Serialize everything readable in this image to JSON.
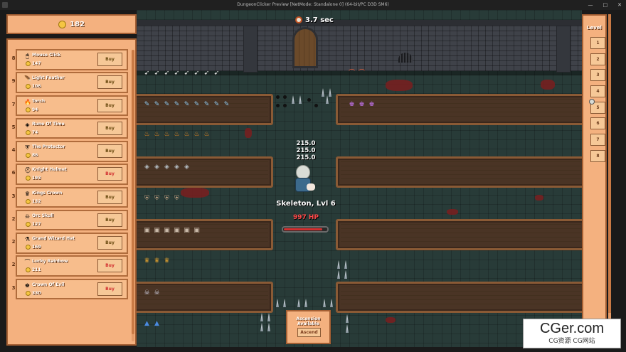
{
  "window": {
    "title": "DungeonClicker Preview [NetMode: Standalone 0] (64-bit/PC D3D SM6)",
    "controls": [
      "—",
      "□",
      "✕"
    ]
  },
  "hud": {
    "timer": "3.7 sec",
    "money": "182"
  },
  "shop": {
    "items": [
      {
        "count": "8",
        "name": "Mouse Click",
        "cost": "147",
        "icon": "mouse-icon",
        "glyph": "🖱",
        "buy": "Buy",
        "affordable": true
      },
      {
        "count": "9",
        "name": "Light Feather",
        "cost": "106",
        "icon": "feather-icon",
        "glyph": "🪶",
        "buy": "Buy",
        "affordable": true
      },
      {
        "count": "7",
        "name": "Torch",
        "cost": "94",
        "icon": "torch-icon",
        "glyph": "🔥",
        "buy": "Buy",
        "affordable": true
      },
      {
        "count": "5",
        "name": "Rune Of Time",
        "cost": "74",
        "icon": "rune-icon",
        "glyph": "◈",
        "buy": "Buy",
        "affordable": true
      },
      {
        "count": "4",
        "name": "The Protector",
        "cost": "86",
        "icon": "shield-icon",
        "glyph": "⛨",
        "buy": "Buy",
        "affordable": true
      },
      {
        "count": "6",
        "name": "Knight Helmet",
        "cost": "193",
        "icon": "helmet-icon",
        "glyph": "⛑",
        "buy": "Buy",
        "affordable": false
      },
      {
        "count": "3",
        "name": "Kings Crown",
        "cost": "132",
        "icon": "crown-icon",
        "glyph": "♛",
        "buy": "Buy",
        "affordable": true
      },
      {
        "count": "2",
        "name": "Orc Skull",
        "cost": "127",
        "icon": "skull-icon",
        "glyph": "☠",
        "buy": "Buy",
        "affordable": true
      },
      {
        "count": "2",
        "name": "Grand Wizard Hat",
        "cost": "169",
        "icon": "wizard-hat-icon",
        "glyph": "⚗",
        "buy": "Buy",
        "affordable": true
      },
      {
        "count": "2",
        "name": "Lucky Rainbow",
        "cost": "211",
        "icon": "rainbow-icon",
        "glyph": "⌒",
        "buy": "Buy",
        "affordable": false
      },
      {
        "count": "3",
        "name": "Crown Of Evil",
        "cost": "330",
        "icon": "evil-crown-icon",
        "glyph": "♚",
        "buy": "Buy",
        "affordable": false
      }
    ]
  },
  "level_panel": {
    "title": "Level",
    "levels": [
      "1",
      "2",
      "3",
      "4",
      "5",
      "6",
      "7",
      "8"
    ],
    "current": "5"
  },
  "enemy": {
    "damage_numbers": [
      "215.0",
      "215.0",
      "215.0"
    ],
    "name": "Skeleton, Lvl 6",
    "hp_text": "997 HP",
    "hp_fraction": 0.9
  },
  "ascension": {
    "title": "Ascension Available",
    "button": "Ascend"
  },
  "watermark": {
    "main": "CGer.com",
    "sub": "CG资源 CG网站"
  },
  "colors": {
    "panel": "#f4b17f",
    "panel_border": "#a45f33",
    "floor": "#283b38",
    "hp_red": "#d23030",
    "locked_text": "#d23030"
  }
}
